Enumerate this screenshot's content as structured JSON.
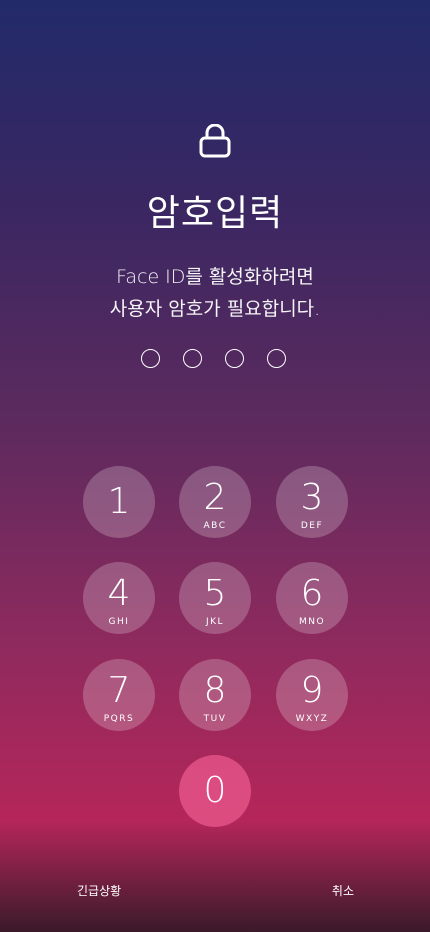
{
  "passcode": {
    "title": "암호입력",
    "subtitle_line1": "Face ID를 활성화하려면",
    "subtitle_line2": "사용자 암호가 필요합니다.",
    "entered_digits": 0,
    "total_digits": 4
  },
  "keypad": {
    "keys": [
      {
        "num": "1",
        "letters": ""
      },
      {
        "num": "2",
        "letters": "ABC"
      },
      {
        "num": "3",
        "letters": "DEF"
      },
      {
        "num": "4",
        "letters": "GHI"
      },
      {
        "num": "5",
        "letters": "JKL"
      },
      {
        "num": "6",
        "letters": "MNO"
      },
      {
        "num": "7",
        "letters": "PQRS"
      },
      {
        "num": "8",
        "letters": "TUV"
      },
      {
        "num": "9",
        "letters": "WXYZ"
      },
      {
        "num": "0",
        "letters": ""
      }
    ]
  },
  "bottom": {
    "emergency_label": "긴급상황",
    "cancel_label": "취소"
  },
  "colors": {
    "top": "#222a6a",
    "bottom": "#b5265a",
    "zero_key": "#d4507e"
  },
  "icons": {
    "lock": "lock-icon"
  }
}
